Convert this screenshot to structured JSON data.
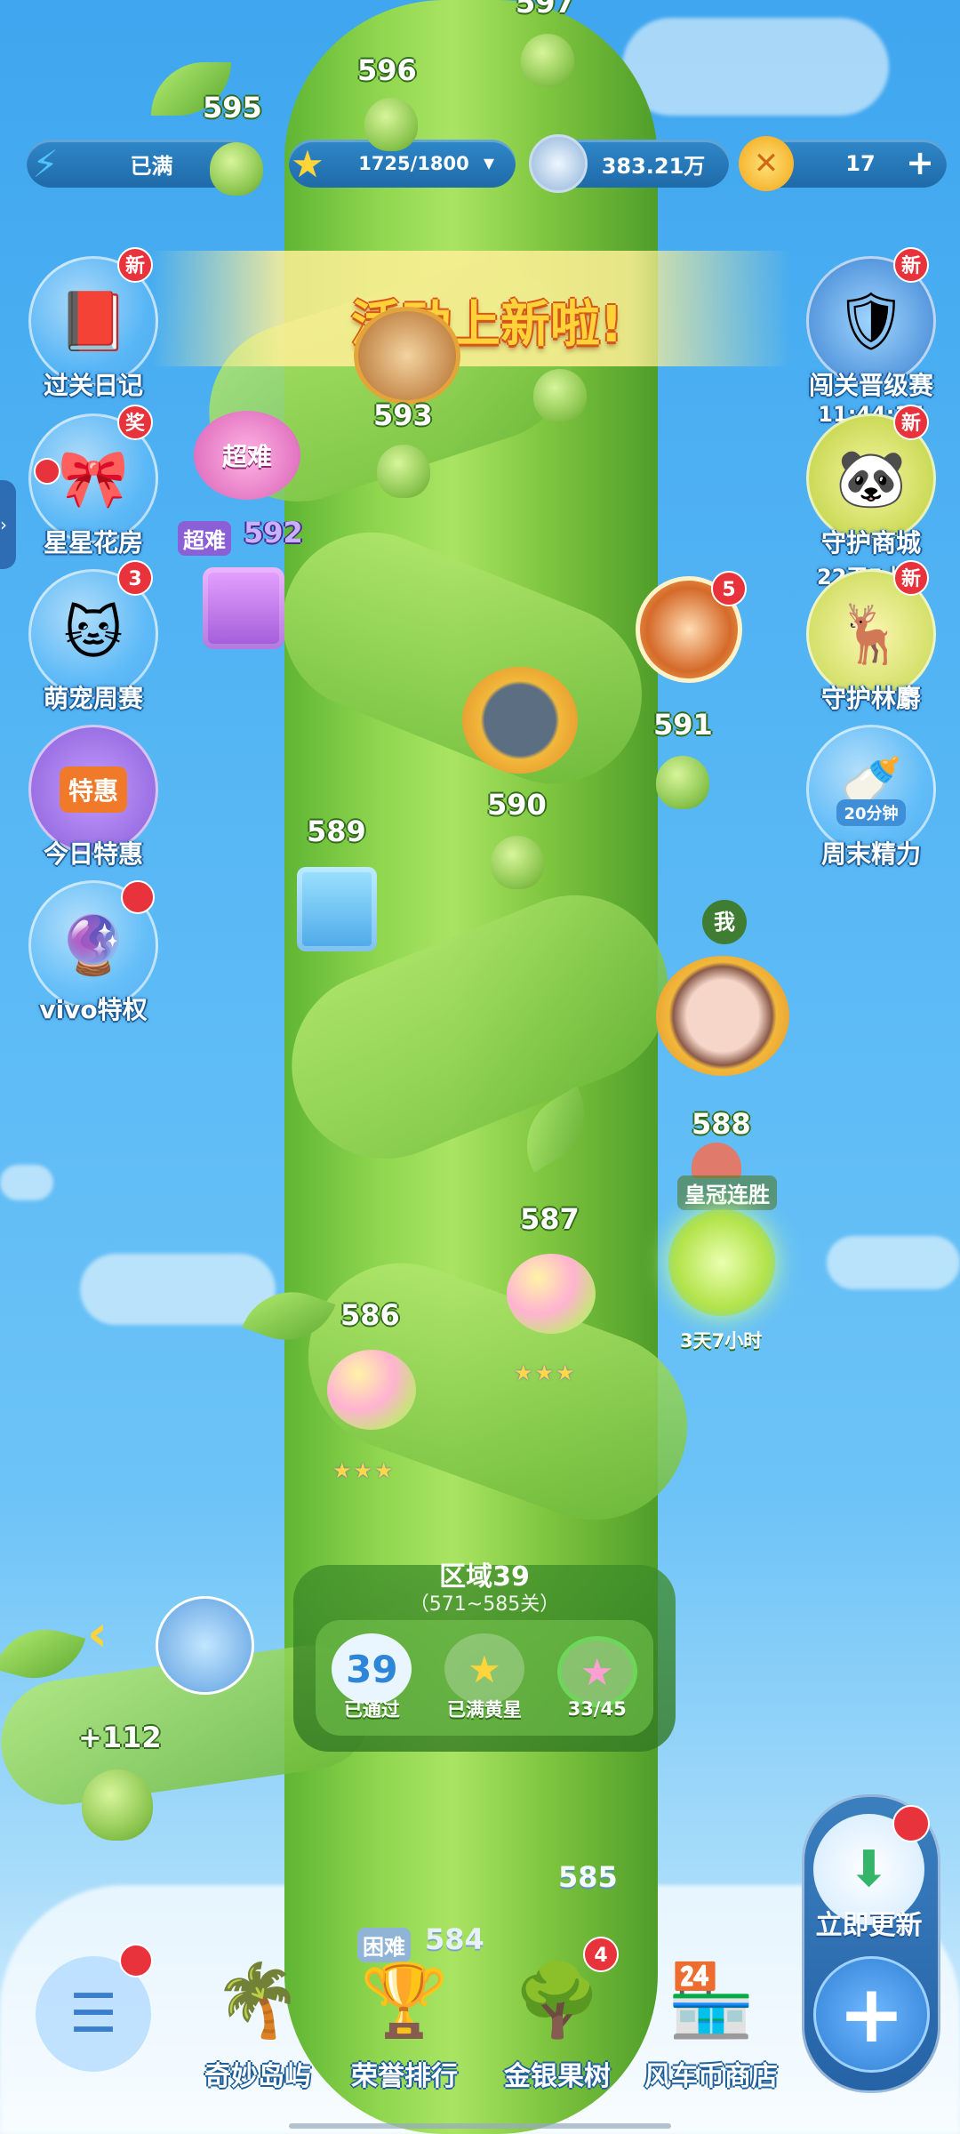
{
  "status_bar": {
    "energy": {
      "text": "已满",
      "plus": "+"
    },
    "stars": {
      "text": "1725/1800",
      "dropdown": "▾"
    },
    "coins": {
      "text": "383.21万"
    },
    "gold": {
      "text": "17",
      "plus": "+"
    }
  },
  "banner": {
    "text": "活动上新啦!"
  },
  "left_menu": [
    {
      "label": "过关日记",
      "badge": "新",
      "icon": "diary-icon"
    },
    {
      "label": "星星花房",
      "badge": "奖",
      "icon": "flower-house-icon"
    },
    {
      "label": "萌宠周赛",
      "badge": "3",
      "icon": "cat-icon"
    },
    {
      "label": "今日特惠",
      "icon_text": "特惠",
      "icon": "shop-icon"
    },
    {
      "label": "vivo特权",
      "icon": "vivo-icon"
    }
  ],
  "right_menu": [
    {
      "label": "闯关晋级赛",
      "badge": "新",
      "sub": "11:44:15",
      "icon": "shield-icon"
    },
    {
      "label": "守护商城",
      "badge": "新",
      "sub": "22天5小时",
      "icon": "panda-store-icon"
    },
    {
      "label": "守护林麝",
      "badge": "新",
      "icon": "musk-deer-icon"
    },
    {
      "label": "周末精力",
      "icon_text": "20分钟",
      "icon": "bottle-icon"
    }
  ],
  "levels": {
    "l597": "597",
    "l596": "596",
    "l595": "595",
    "l593": "593",
    "l592_tag": "超难",
    "l592": "592",
    "l592_flower": "超难",
    "l591": "591",
    "l591_badge": "5",
    "l590": "590",
    "l589": "589",
    "me": "我",
    "l588": "588",
    "crown": "皇冠连胜",
    "timer": "3天7小时",
    "l587": "587",
    "l586": "586",
    "plus112": "+112",
    "l585": "585",
    "l584_tag": "困难",
    "l584": "584",
    "stars3": "★★★"
  },
  "region": {
    "title": "区域39",
    "range": "（571~585关）",
    "cells": [
      {
        "value": "39",
        "caption": "已通过"
      },
      {
        "value": "★",
        "caption": "已满黄星"
      },
      {
        "value": "★",
        "caption": "33/45"
      }
    ]
  },
  "bottom_nav": [
    {
      "label": "奇妙岛屿",
      "icon": "island-icon"
    },
    {
      "label": "荣誉排行",
      "icon": "trophy-icon",
      "icon_text": "1"
    },
    {
      "label": "金银果树",
      "icon": "tree-icon",
      "badge": "4"
    },
    {
      "label": "风车币商店",
      "icon": "store-icon"
    }
  ],
  "update_panel": {
    "label": "立即更新",
    "plus": "+"
  },
  "back_arrow": "‹"
}
